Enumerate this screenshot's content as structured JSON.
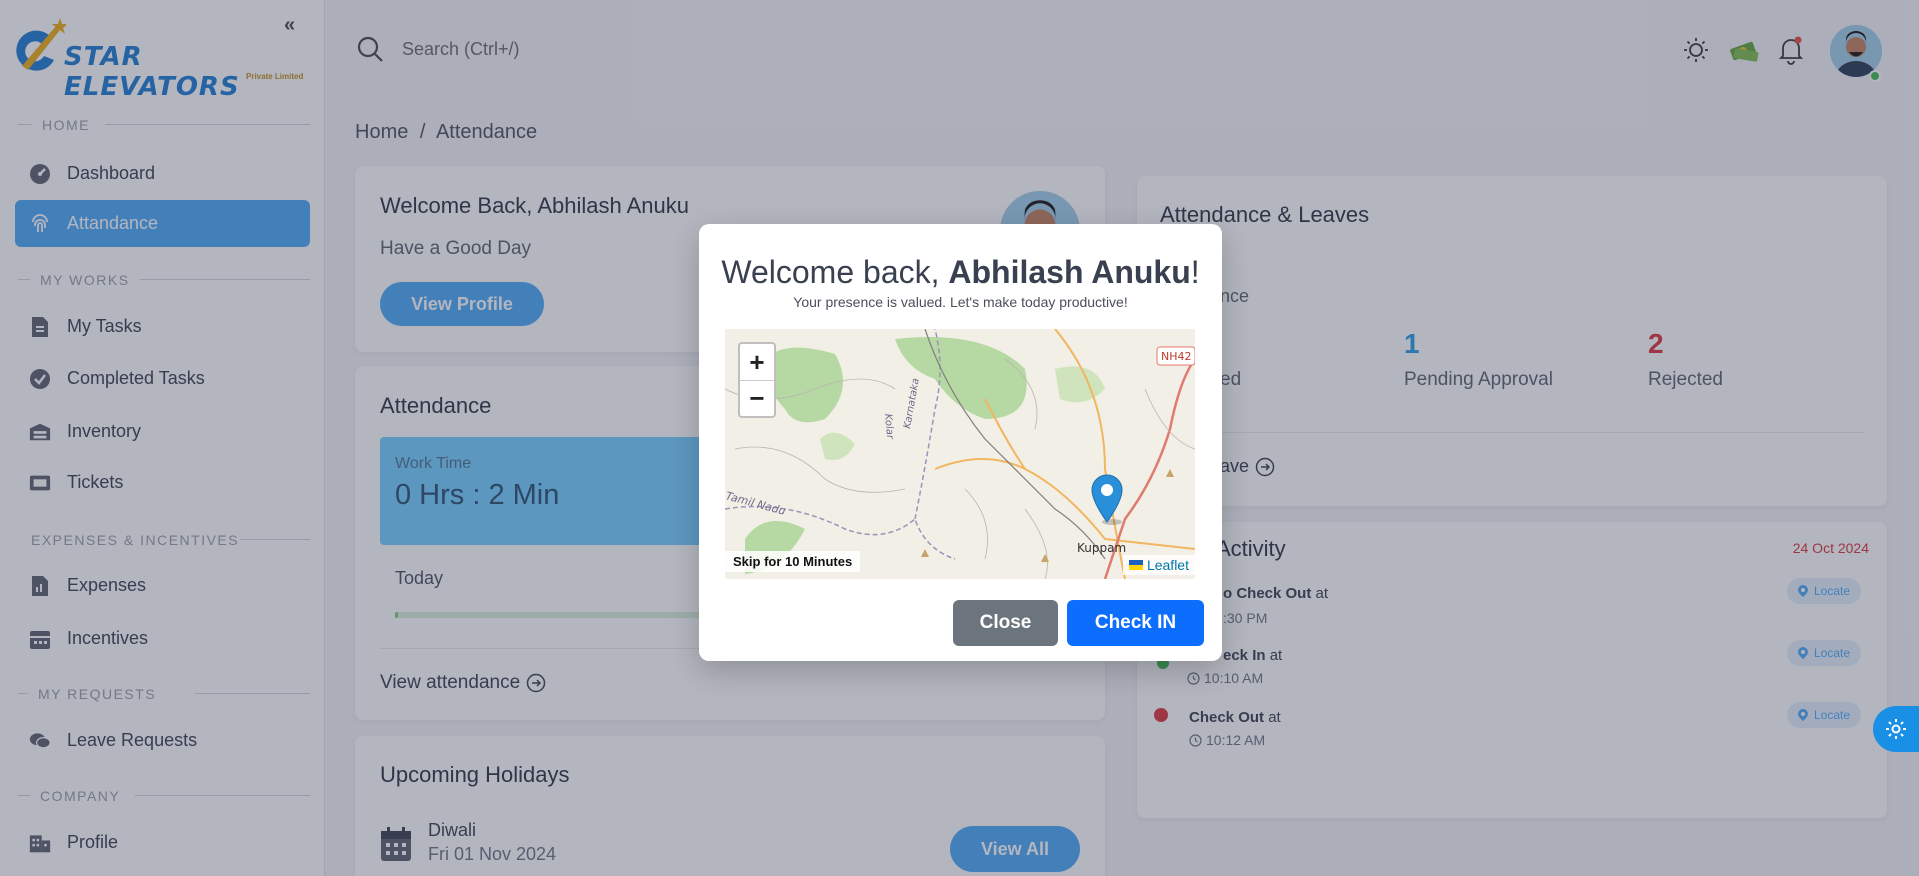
{
  "colors": {
    "accent": "#5ab2f8",
    "primary_button": "#0d6efd",
    "secondary_button": "#6c757d",
    "pending": "#3aa5e8",
    "rejected": "#e0454b",
    "date_red": "#e0454b",
    "progress": "#8ad58a"
  },
  "brand": {
    "name": "STAR ELEVATORS",
    "tagline": "Private Limited",
    "collapse_icon": "double-chevron-left-icon"
  },
  "sidebar": {
    "sections": [
      {
        "title": "HOME"
      },
      {
        "title": "MY WORKS"
      },
      {
        "title": "EXPENSES & INCENTIVES"
      },
      {
        "title": "MY REQUESTS"
      },
      {
        "title": "COMPANY"
      }
    ],
    "items": [
      {
        "label": "Dashboard",
        "icon": "gauge-icon"
      },
      {
        "label": "Attandance",
        "icon": "fingerprint-icon",
        "active": true
      },
      {
        "label": "My Tasks",
        "icon": "file-icon"
      },
      {
        "label": "Completed Tasks",
        "icon": "check-badge-icon"
      },
      {
        "label": "Inventory",
        "icon": "warehouse-icon"
      },
      {
        "label": "Tickets",
        "icon": "ticket-icon"
      },
      {
        "label": "Expenses",
        "icon": "receipt-icon"
      },
      {
        "label": "Incentives",
        "icon": "gift-icon"
      },
      {
        "label": "Leave Requests",
        "icon": "chat-icon"
      },
      {
        "label": "Profile",
        "icon": "building-icon"
      }
    ]
  },
  "topbar": {
    "search_placeholder": "Search (Ctrl+/)",
    "icons": [
      "sun-icon",
      "money-icon",
      "bell-icon"
    ]
  },
  "breadcrumb": {
    "home": "Home",
    "separator": "/",
    "current": "Attendance"
  },
  "welcome_card": {
    "title": "Welcome Back, Abhilash Anuku",
    "subtitle": "Have a Good Day",
    "button": "View Profile"
  },
  "attendance_card": {
    "title": "Attendance",
    "work_time_label": "Work Time",
    "work_time_value": "0 Hrs : 2 Min",
    "today_label": "Today",
    "today_progress": 0.01,
    "link": "View attendance"
  },
  "holidays_card": {
    "title": "Upcoming Holidays",
    "holiday_name": "Diwali",
    "holiday_date": "Fri 01 Nov 2024",
    "button": "View All"
  },
  "leaves_card": {
    "title": "Attendance & Leaves",
    "partial_label": "ance",
    "stats": [
      {
        "value": "",
        "label": "ed"
      },
      {
        "value": "1",
        "label": "Pending Approval"
      },
      {
        "value": "2",
        "label": "Rejected"
      }
    ],
    "link": "eave"
  },
  "activity_card": {
    "title": "Activity",
    "date": "24 Oct 2024",
    "items": [
      {
        "title": "o Check Out",
        "at": "at",
        "time": ":30 PM",
        "button": "Locate"
      },
      {
        "title": "eck In",
        "at": "at",
        "time": "10:10 AM",
        "button": "Locate"
      },
      {
        "title": "Check Out",
        "at": "at",
        "time": "10:12 AM",
        "button": "Locate"
      }
    ]
  },
  "modal": {
    "title_prefix": "Welcome back, ",
    "title_name": "Abhilash Anuku",
    "title_suffix": "!",
    "subtitle": "Your presence is valued. Let's make today productive!",
    "map": {
      "zoom_in": "+",
      "zoom_out": "−",
      "skip": "Skip for 10 Minutes",
      "attribution": "Leaflet",
      "labels": [
        "NH42",
        "Karnataka",
        "Kolar",
        "Tamil Nadu",
        "Kuppam"
      ]
    },
    "close_button": "Close",
    "checkin_button": "Check IN"
  }
}
